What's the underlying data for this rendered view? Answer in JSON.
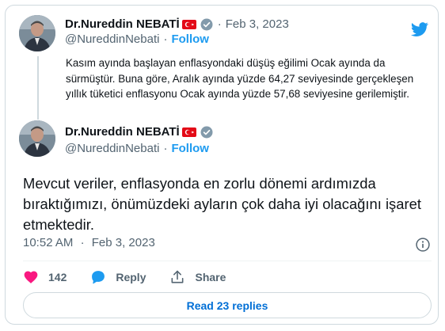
{
  "quoted_tweet": {
    "display_name": "Dr.Nureddin NEBATİ",
    "handle": "@NureddinNebati",
    "date": "Feb 3, 2023",
    "follow_label": "Follow",
    "text": "Kasım ayında başlayan enflasyondaki düşüş eğilimi Ocak ayında da sürmüştür. Buna göre, Aralık ayında yüzde 64,27 seviyesinde gerçekleşen yıllık tüketici enflasyonu Ocak ayında yüzde 57,68 seviyesine gerilemiştir."
  },
  "main_tweet": {
    "display_name": "Dr.Nureddin NEBATİ",
    "handle": "@NureddinNebati",
    "follow_label": "Follow",
    "text": "Mevcut veriler, enflasyonda en zorlu dönemi ardımızda bıraktığımızı, önümüzdeki ayların çok daha iyi olacağını işaret etmektedir.",
    "time": "10:52 AM",
    "date": "Feb 3, 2023"
  },
  "separator": "·",
  "actions": {
    "like_count": "142",
    "reply_label": "Reply",
    "share_label": "Share"
  },
  "read_replies_label": "Read 23 replies",
  "icons": {
    "brand": "twitter-bird-icon",
    "verified": "verified-badge-icon",
    "flag": "turkey-flag-icon",
    "like": "heart-icon",
    "reply": "reply-bubble-icon",
    "share": "share-icon",
    "info": "info-icon"
  },
  "colors": {
    "brand_blue": "#1d9bf0",
    "like_pink": "#f91880",
    "link_blue": "#006fd6",
    "secondary_text": "#536471",
    "border": "#cfd9de"
  }
}
